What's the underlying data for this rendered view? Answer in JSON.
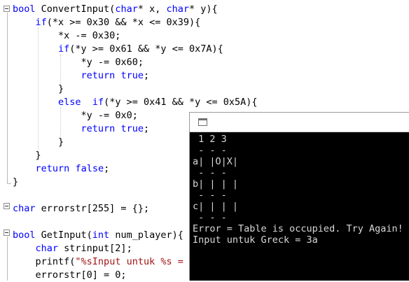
{
  "editor": {
    "lines": [
      {
        "id": "l1",
        "tokens": [
          {
            "t": "bool",
            "k": "kw"
          },
          {
            "t": " ConvertInput("
          },
          {
            "t": "char",
            "k": "kw"
          },
          {
            "t": "* x, "
          },
          {
            "t": "char",
            "k": "kw"
          },
          {
            "t": "* y){"
          }
        ]
      },
      {
        "id": "l2",
        "indent": "    ",
        "tokens": [
          {
            "t": "if",
            "k": "kw"
          },
          {
            "t": "(*x >= 0x30 && *x <= 0x39){"
          }
        ]
      },
      {
        "id": "l3",
        "indent": "        ",
        "tokens": [
          {
            "t": "*x -= 0x30;"
          }
        ]
      },
      {
        "id": "l4",
        "indent": "        ",
        "tokens": [
          {
            "t": "if",
            "k": "kw"
          },
          {
            "t": "(*y >= 0x61 && *y <= 0x7A){"
          }
        ]
      },
      {
        "id": "l5",
        "indent": "            ",
        "tokens": [
          {
            "t": "*y -= 0x60;"
          }
        ]
      },
      {
        "id": "l6",
        "indent": "            ",
        "tokens": [
          {
            "t": "return",
            "k": "kw"
          },
          {
            "t": " "
          },
          {
            "t": "true",
            "k": "kw"
          },
          {
            "t": ";"
          }
        ]
      },
      {
        "id": "l7",
        "indent": "        ",
        "tokens": [
          {
            "t": "}"
          }
        ]
      },
      {
        "id": "l8",
        "indent": "        ",
        "tokens": [
          {
            "t": "else",
            "k": "kw"
          },
          {
            "t": "  "
          },
          {
            "t": "if",
            "k": "kw"
          },
          {
            "t": "(*y >= 0x41 && *y <= 0x5A){"
          }
        ]
      },
      {
        "id": "l9",
        "indent": "            ",
        "tokens": [
          {
            "t": "*y -= 0x0;"
          }
        ]
      },
      {
        "id": "l10",
        "indent": "            ",
        "tokens": [
          {
            "t": "return",
            "k": "kw"
          },
          {
            "t": " "
          },
          {
            "t": "true",
            "k": "kw"
          },
          {
            "t": ";"
          }
        ]
      },
      {
        "id": "l11",
        "indent": "        ",
        "tokens": [
          {
            "t": "}"
          }
        ]
      },
      {
        "id": "l12",
        "indent": "    ",
        "tokens": [
          {
            "t": "}"
          }
        ]
      },
      {
        "id": "l13",
        "indent": "    ",
        "tokens": [
          {
            "t": "return",
            "k": "kw"
          },
          {
            "t": " "
          },
          {
            "t": "false",
            "k": "kw"
          },
          {
            "t": ";"
          }
        ]
      },
      {
        "id": "l14",
        "tokens": [
          {
            "t": "}"
          }
        ]
      },
      {
        "id": "l15",
        "tokens": []
      },
      {
        "id": "l16",
        "tokens": [
          {
            "t": "char",
            "k": "kw"
          },
          {
            "t": " errorstr[255] = {};"
          }
        ]
      },
      {
        "id": "l17",
        "tokens": []
      },
      {
        "id": "l18",
        "tokens": [
          {
            "t": "bool",
            "k": "kw"
          },
          {
            "t": " GetInput("
          },
          {
            "t": "int",
            "k": "kw"
          },
          {
            "t": " num_player){"
          }
        ]
      },
      {
        "id": "l19",
        "indent": "    ",
        "tokens": [
          {
            "t": "char",
            "k": "kw"
          },
          {
            "t": " strinput[2];"
          }
        ]
      },
      {
        "id": "l20",
        "indent": "    ",
        "tokens": [
          {
            "t": "printf("
          },
          {
            "t": "\"%sInput untuk %s = \"",
            "k": "str"
          },
          {
            "t": ","
          }
        ]
      },
      {
        "id": "l21",
        "indent": "    ",
        "tokens": [
          {
            "t": "errorstr[0] = 0;"
          }
        ]
      }
    ]
  },
  "console": {
    "icon": "console-window-icon",
    "lines": [
      " 1 2 3",
      " - - -",
      "a| |O|X|",
      " - - -",
      "b| | | |",
      " - - -",
      "c| | | |",
      " - - -",
      "Error = Table is occupied. Try Again!",
      "Input untuk Greck = 3a"
    ]
  },
  "colors": {
    "keyword": "#0000ff",
    "string": "#a31515",
    "console_bg": "#000000",
    "console_text": "#d8d8d8"
  }
}
